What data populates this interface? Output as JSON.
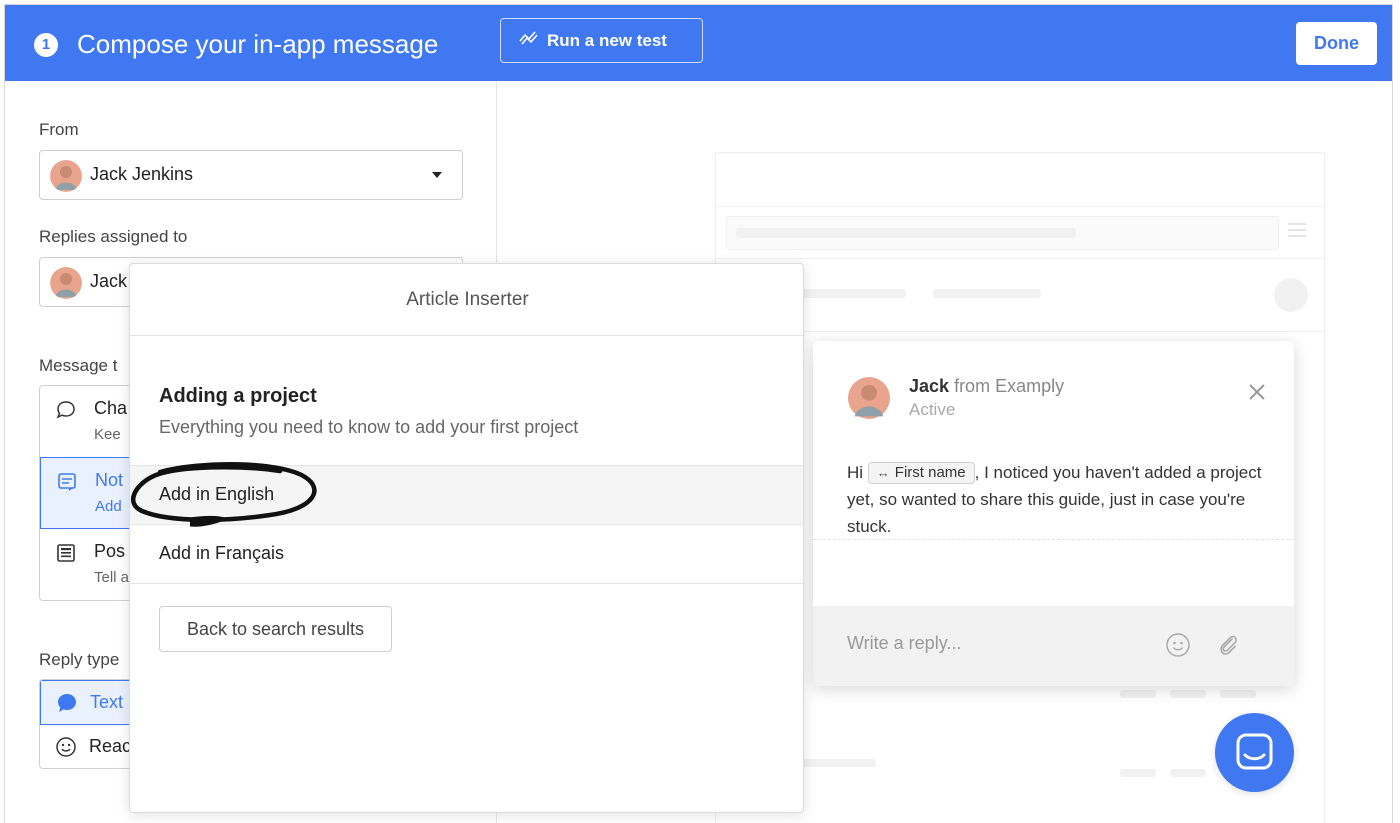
{
  "header": {
    "step_number": "1",
    "title": "Compose your in-app message",
    "run_test_label": "Run a new test",
    "done_label": "Done",
    "accent_color": "#3f78f0"
  },
  "left_panel": {
    "from_label": "From",
    "from_value": "Jack Jenkins",
    "replies_label": "Replies assigned to",
    "replies_value": "Jack",
    "message_type_label": "Message t",
    "message_types": [
      {
        "icon": "chat-bubble-icon",
        "title": "Cha",
        "subtitle": "Kee"
      },
      {
        "icon": "note-icon",
        "title": "Not",
        "subtitle": "Add"
      },
      {
        "icon": "post-icon",
        "title": "Pos",
        "subtitle": "Tell a"
      }
    ],
    "reply_type_label": "Reply type",
    "reply_types": [
      {
        "icon": "speech-bubble-icon",
        "label": "Text"
      },
      {
        "icon": "smiley-icon",
        "label": "Reac"
      }
    ]
  },
  "article_inserter": {
    "title": "Article Inserter",
    "article_title": "Adding a project",
    "article_description": "Everything you need to know to add your first project",
    "languages": [
      {
        "label": "Add in English"
      },
      {
        "label": "Add in Français"
      }
    ],
    "back_label": "Back to search results"
  },
  "messenger_preview": {
    "sender_name": "Jack",
    "sender_suffix": "from Examply",
    "status": "Active",
    "body_prefix": "Hi",
    "attribute_chip": "First name",
    "attribute_chip_symbol": "↔",
    "body_suffix": ", I noticed you haven't added a project yet, so wanted to share this guide, just in case you're stuck.",
    "reply_placeholder": "Write a reply..."
  }
}
